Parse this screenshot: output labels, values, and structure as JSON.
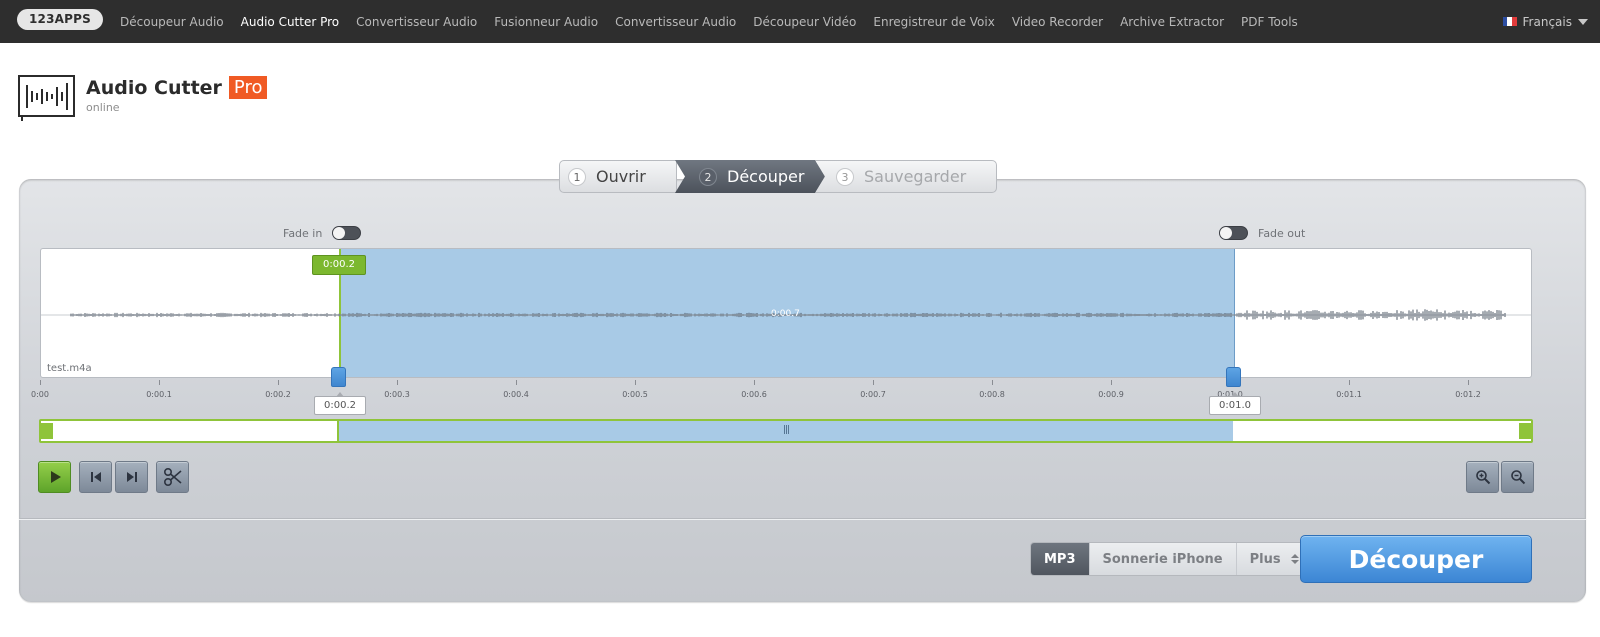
{
  "topbar": {
    "brand": "123APPS",
    "nav": [
      {
        "label": "Découpeur Audio",
        "active": false
      },
      {
        "label": "Audio Cutter Pro",
        "active": true
      },
      {
        "label": "Convertisseur Audio",
        "active": false
      },
      {
        "label": "Fusionneur Audio",
        "active": false
      },
      {
        "label": "Convertisseur Audio",
        "active": false
      },
      {
        "label": "Découpeur Vidéo",
        "active": false
      },
      {
        "label": "Enregistreur de Voix",
        "active": false
      },
      {
        "label": "Video Recorder",
        "active": false
      },
      {
        "label": "Archive Extractor",
        "active": false
      },
      {
        "label": "PDF Tools",
        "active": false
      }
    ],
    "language": "Français"
  },
  "header": {
    "title": "Audio Cutter",
    "badge": "Pro",
    "subtitle": "online"
  },
  "steps": [
    {
      "num": "1",
      "label": "Ouvrir",
      "state": "done"
    },
    {
      "num": "2",
      "label": "Découper",
      "state": "active"
    },
    {
      "num": "3",
      "label": "Sauvegarder",
      "state": "pending"
    }
  ],
  "editor": {
    "fade_in_label": "Fade in",
    "fade_out_label": "Fade out",
    "fade_in_on": false,
    "fade_out_on": false,
    "filename": "test.m4a",
    "start_time_flag": "0:00.2",
    "selection_duration": "0:00.7",
    "start_label": "0:00.2",
    "end_label": "0:01.0",
    "selection_start_s": 0.25,
    "selection_end_s": 1.0,
    "ruler_ticks": [
      "0:00",
      "0:00.1",
      "0:00.2",
      "0:00.3",
      "0:00.4",
      "0:00.5",
      "0:00.6",
      "0:00.7",
      "0:00.8",
      "0:00.9",
      "0:01.0",
      "0:01.1",
      "0:01.2"
    ]
  },
  "controls": {
    "play_icon": "play-icon",
    "prev_icon": "skip-back-icon",
    "next_icon": "skip-forward-icon",
    "cut_mode_icon": "scissors-icon",
    "zoom_in_icon": "zoom-in-icon",
    "zoom_out_icon": "zoom-out-icon"
  },
  "output": {
    "formats": [
      "MP3",
      "Sonnerie iPhone",
      "Plus"
    ],
    "selected": "MP3",
    "cut_button": "Découper"
  },
  "colors": {
    "accent_orange": "#f05a24",
    "selection_blue": "#a8cae6",
    "marker_green": "#8fc43a",
    "cut_button_blue": "#3c86d4"
  }
}
